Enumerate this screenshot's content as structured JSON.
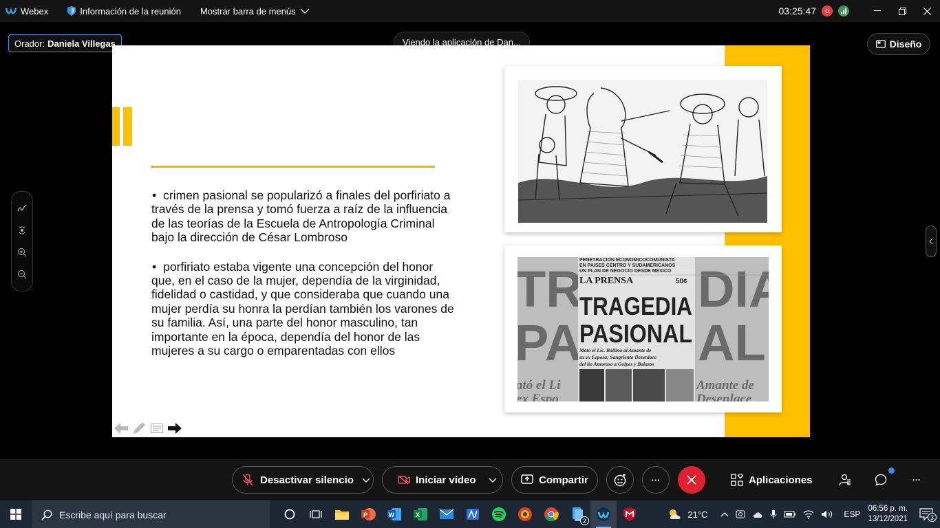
{
  "titlebar": {
    "app_name": "Webex",
    "meeting_info": "Información de la reunión",
    "menu_toggle": "Mostrar barra de menús",
    "clock": "03:25:47",
    "rec_badge": "o"
  },
  "meeting": {
    "speaker_label": "Orador:",
    "speaker_name": "Daniela Villegas",
    "viewing_text": "Viendo la aplicación de Dan...",
    "layout_button": "Diseño"
  },
  "slide": {
    "bullets": [
      "crimen pasional se popularizó a finales del porfiriato a través de la prensa y tomó fuerza a raíz de la influencia de las teorías de la Escuela de Antropología Criminal bajo la dirección de César Lombroso",
      "porfiriato estaba vigente una concepción del honor que, en el caso de la mujer, dependía de la virginidad, fidelidad o castidad, y que consideraba que cuando una mujer perdía su honra la perdían también los varones de su familia. Así, una parte del honor masculino, tan importante en la época, dependía del honor de las mujeres a su cargo o emparentadas con ellos"
    ],
    "bullet_symbol": "•",
    "newspaper": {
      "top_line1": "PENETRACION ECONOMICOCOMUNISTA",
      "top_line2": "EN PAISES CENTRO Y SUDAMERICANOS",
      "top_line3": "UN PLAN DE NEGOCIO DESDE MEXICO",
      "masthead": "LA PRENSA",
      "price": "50¢",
      "headline1": "TRAGEDIA",
      "headline2": "PASIONAL",
      "sub1": "Mató el Lic. Ballina al Amante de",
      "sub2": "su ex Esposa; Sangriento Desenlace",
      "sub3": "del lío Amoroso a Golpes y Balazos",
      "bg_left1": "TRA",
      "bg_left2": "PAS",
      "bg_left3": "ató el Li",
      "bg_left4": "ex Espo",
      "bg_right1": "DIA",
      "bg_right2": "AL",
      "bg_right3": "Amante de",
      "bg_right4": "Desenlace"
    }
  },
  "controls": {
    "mute": "Desactivar silencio",
    "video": "Iniciar vídeo",
    "share": "Compartir",
    "more": "···",
    "apps": "Aplicaciones"
  },
  "taskbar": {
    "search_placeholder": "Escribe aquí para buscar",
    "weather": "21°C",
    "lang": "ESP",
    "time": "06:56 p. m.",
    "date": "13/12/2021",
    "notifications": "3",
    "files_badge": "2"
  },
  "colors": {
    "accent_yellow": "#ffc000",
    "end_red": "#e02030",
    "taskbar": "#1d2733"
  }
}
